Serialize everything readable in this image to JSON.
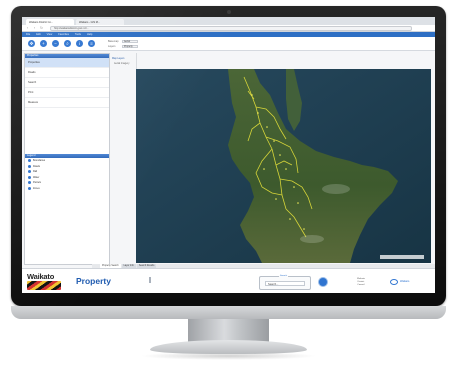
{
  "browser": {
    "tabs": [
      {
        "label": "Waikato District Co...",
        "active": true
      },
      {
        "label": "Waikato - GIS M...",
        "active": false
      }
    ],
    "url": "http://waikatodistrict.govt.nz/...",
    "menu": [
      "File",
      "Edit",
      "View",
      "Favorites",
      "Tools",
      "Help"
    ]
  },
  "toolbar": {
    "tools": [
      "pan-icon",
      "zoom-in-icon",
      "zoom-out-icon",
      "search-icon",
      "identify-icon",
      "layers-icon"
    ],
    "field1_label": "Basemap",
    "field1_value": "Aerial",
    "field2_label": "Layers",
    "field2_value": "Property"
  },
  "sidebar": {
    "header": "Properties",
    "items": [
      "Properties",
      "Roads",
      "Search",
      "Print",
      "Measure"
    ],
    "selected_index": 0,
    "legend_header": "Legend",
    "legend_items": [
      "Boundaries",
      "Roads",
      "Rail",
      "Water",
      "Parcels",
      "Zones"
    ]
  },
  "midpanel": {
    "tree": [
      "Map Layers",
      "Aerial Imagery"
    ]
  },
  "map": {
    "colors": {
      "sea": "#1e3d50",
      "land": "#3f5a2e",
      "highlight": "#e6e23a"
    }
  },
  "bottom_tabs": [
    {
      "label": "Property Search",
      "active": true
    },
    {
      "label": "Layer Info",
      "active": false
    },
    {
      "label": "Search Results",
      "active": false
    }
  ],
  "footer": {
    "logo_text": "Waikato",
    "title": "Property",
    "search_legend": "Search",
    "search_value": "Search...",
    "info_text_lines": [
      "Waikato",
      "District",
      "Council"
    ],
    "gov_text": "Waikato"
  }
}
